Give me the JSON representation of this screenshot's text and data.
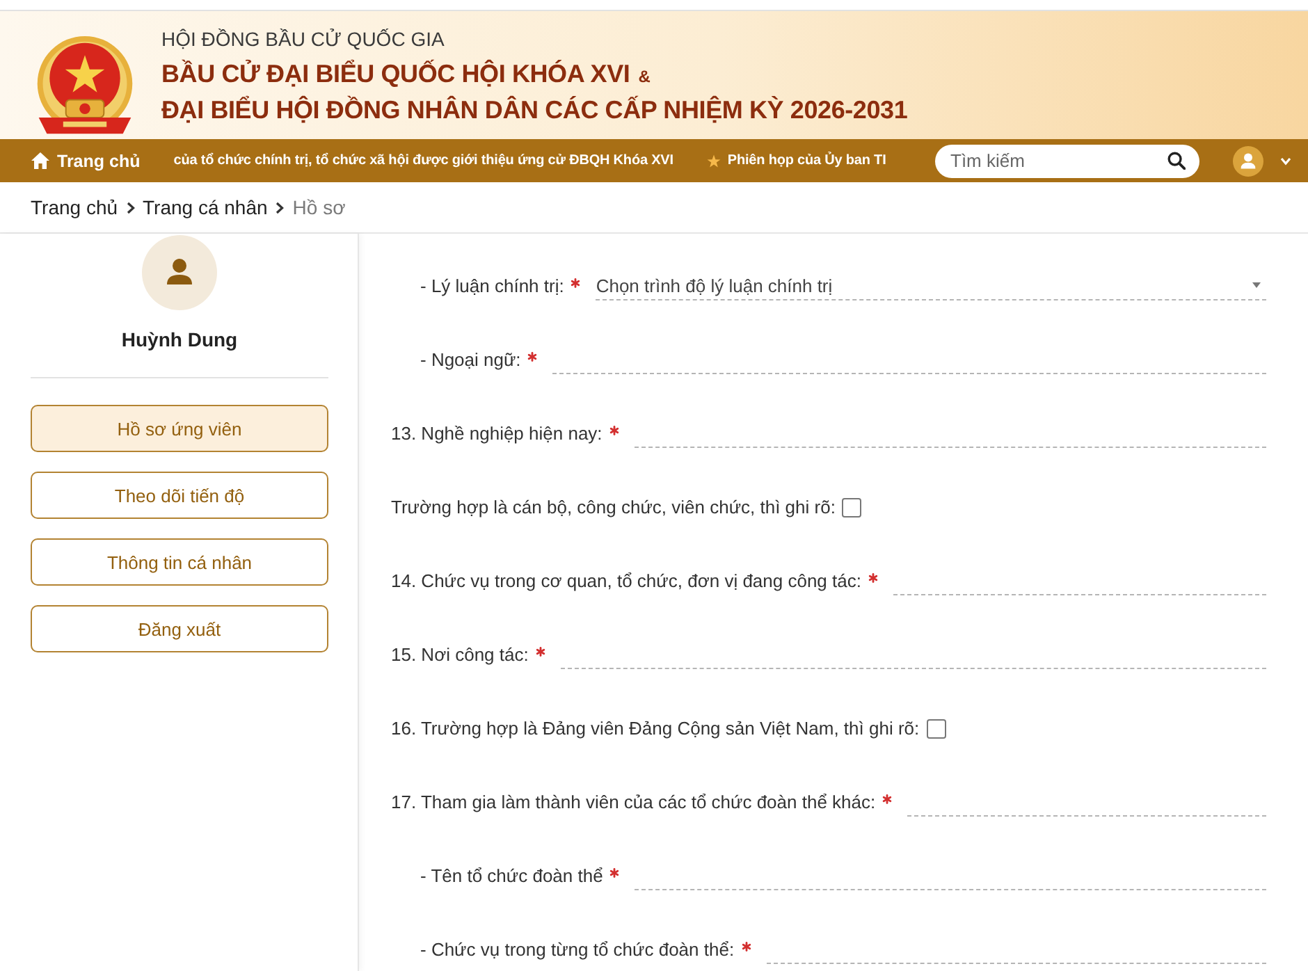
{
  "header": {
    "agency": "HỘI ĐỒNG BẦU CỬ QUỐC GIA",
    "title_line_1": "BẦU CỬ ĐẠI BIỂU QUỐC HỘI KHÓA XVI",
    "ampersand": "&",
    "title_line_2": "ĐẠI BIỂU HỘI ĐỒNG NHÂN DÂN CÁC CẤP NHIỆM KỲ 2026-2031"
  },
  "nav": {
    "items": [
      {
        "kind": "home",
        "label": "Trang chủ"
      },
      {
        "kind": "plain",
        "label": "của tổ chức chính trị, tổ chức xã hội được giới thiệu ứng cử ĐBQH Khóa XVI"
      },
      {
        "kind": "star",
        "label": "Phiên họp của Ủy ban TI"
      }
    ],
    "search": {
      "placeholder": "Tìm kiếm"
    }
  },
  "breadcrumb": [
    {
      "label": "Trang chủ",
      "current": false
    },
    {
      "label": "Trang cá nhân",
      "current": false
    },
    {
      "label": "Hồ sơ",
      "current": true
    }
  ],
  "sidebar": {
    "user_name": "Huỳnh Dung",
    "menu": [
      {
        "label": "Hồ sơ ứng viên",
        "selected": true
      },
      {
        "label": "Theo dõi tiến độ",
        "selected": false
      },
      {
        "label": "Thông tin cá nhân",
        "selected": false
      },
      {
        "label": "Đăng xuất",
        "selected": false
      }
    ]
  },
  "form": {
    "items": [
      {
        "kind": "group",
        "children": [
          {
            "kind": "select",
            "label": "- Lý luận chính trị:",
            "required": true,
            "placeholder": "Chọn trình độ lý luận chính trị"
          },
          {
            "kind": "text",
            "label": "- Ngoại ngữ:",
            "required": true
          }
        ]
      },
      {
        "kind": "text",
        "label": "13. Nghề nghiệp hiện nay:",
        "required": true
      },
      {
        "kind": "checkbox",
        "label": "Trường hợp là cán bộ, công chức, viên chức, thì ghi rõ:",
        "checked": false
      },
      {
        "kind": "text",
        "label": "14. Chức vụ trong cơ quan, tổ chức, đơn vị đang công tác:",
        "required": true
      },
      {
        "kind": "text",
        "label": "15. Nơi công tác:",
        "required": true
      },
      {
        "kind": "checkbox",
        "label": "16. Trường hợp là Đảng viên Đảng Cộng sản Việt Nam, thì ghi rõ:",
        "checked": false
      },
      {
        "kind": "text",
        "label": "17. Tham gia làm thành viên của các tổ chức đoàn thể khác:",
        "required": true,
        "children": [
          {
            "kind": "text",
            "label": "- Tên tổ chức đoàn thể",
            "required": true
          },
          {
            "kind": "text",
            "label": "- Chức vụ trong từng tổ chức đoàn thể:",
            "required": true
          }
        ]
      }
    ]
  }
}
